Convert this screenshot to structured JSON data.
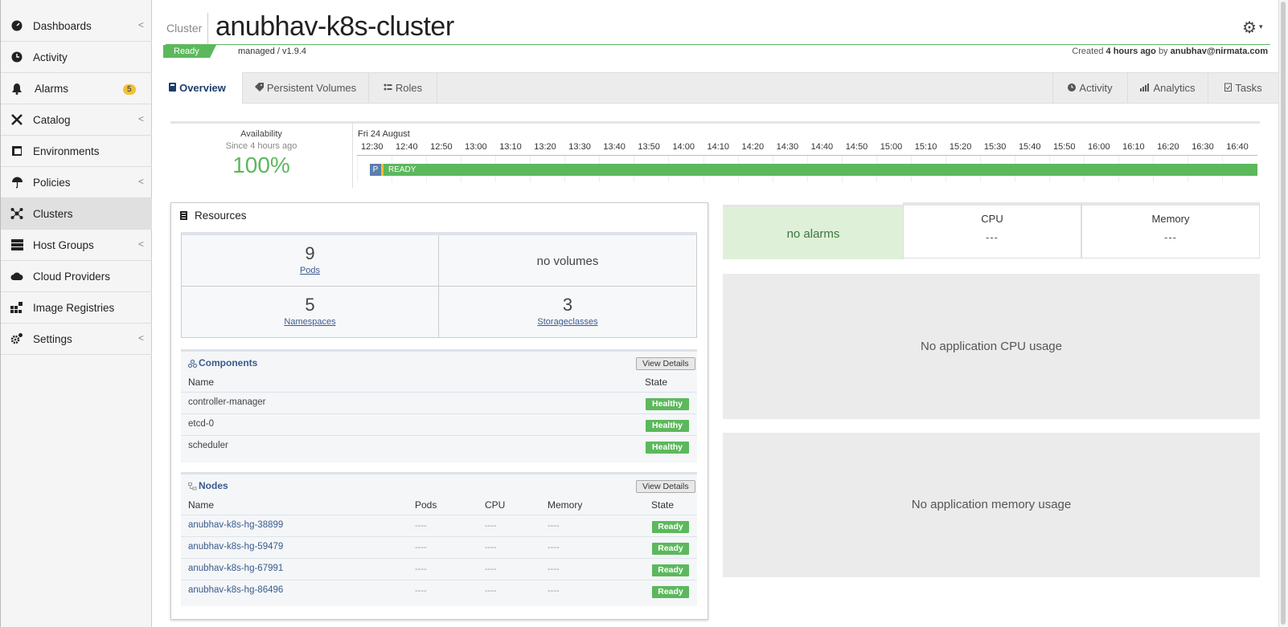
{
  "sidebar": {
    "items": [
      {
        "label": "Dashboards",
        "icon": "dashboard-icon",
        "chevron": "<"
      },
      {
        "label": "Activity",
        "icon": "activity-icon"
      },
      {
        "label": "Alarms",
        "icon": "bell-icon",
        "badge": "5"
      },
      {
        "label": "Catalog",
        "icon": "tools-icon",
        "chevron": "<"
      },
      {
        "label": "Environments",
        "icon": "environment-icon"
      },
      {
        "label": "Policies",
        "icon": "umbrella-icon",
        "chevron": "<"
      },
      {
        "label": "Clusters",
        "icon": "cluster-icon",
        "active": true
      },
      {
        "label": "Host Groups",
        "icon": "server-icon",
        "chevron": "<"
      },
      {
        "label": "Cloud Providers",
        "icon": "cloud-icon"
      },
      {
        "label": "Image Registries",
        "icon": "registry-icon"
      },
      {
        "label": "Settings",
        "icon": "cogs-icon",
        "chevron": "<"
      }
    ]
  },
  "header": {
    "sub": "Cluster",
    "title": "anubhav-k8s-cluster",
    "status": "Ready",
    "managed": "managed / v1.9.4",
    "created_prefix": "Created",
    "created_ago": "4 hours ago",
    "created_by_word": "by",
    "created_by": "anubhav@nirmata.com",
    "gear_caret": "▾"
  },
  "tabs": {
    "overview": "Overview",
    "pv": "Persistent Volumes",
    "roles": "Roles",
    "activity": "Activity",
    "analytics": "Analytics",
    "tasks": "Tasks"
  },
  "availability": {
    "label": "Availability",
    "since": "Since 4 hours ago",
    "percent": "100%"
  },
  "timeline": {
    "date": "Fri 24 August",
    "ticks": [
      "12:30",
      "12:40",
      "12:50",
      "13:00",
      "13:10",
      "13:20",
      "13:30",
      "13:40",
      "13:50",
      "14:00",
      "14:10",
      "14:20",
      "14:30",
      "14:40",
      "14:50",
      "15:00",
      "15:10",
      "15:20",
      "15:30",
      "15:40",
      "15:50",
      "16:00",
      "16:10",
      "16:20",
      "16:30",
      "16:40"
    ],
    "p_label": "P",
    "bar_label": "READY"
  },
  "resources": {
    "title": "Resources",
    "pods_count": "9",
    "pods_label": "Pods",
    "volumes": "no volumes",
    "ns_count": "5",
    "ns_label": "Namespaces",
    "sc_count": "3",
    "sc_label": "Storageclasses"
  },
  "components": {
    "title": "Components",
    "view_details": "View Details",
    "col_name": "Name",
    "col_state": "State",
    "rows": [
      {
        "name": "controller-manager",
        "state": "Healthy"
      },
      {
        "name": "etcd-0",
        "state": "Healthy"
      },
      {
        "name": "scheduler",
        "state": "Healthy"
      }
    ]
  },
  "nodes": {
    "title": "Nodes",
    "view_details": "View Details",
    "col_name": "Name",
    "col_pods": "Pods",
    "col_cpu": "CPU",
    "col_memory": "Memory",
    "col_state": "State",
    "rows": [
      {
        "name": "anubhav-k8s-hg-38899",
        "pods": "----",
        "cpu": "----",
        "memory": "----",
        "state": "Ready"
      },
      {
        "name": "anubhav-k8s-hg-59479",
        "pods": "----",
        "cpu": "----",
        "memory": "----",
        "state": "Ready"
      },
      {
        "name": "anubhav-k8s-hg-67991",
        "pods": "----",
        "cpu": "----",
        "memory": "----",
        "state": "Ready"
      },
      {
        "name": "anubhav-k8s-hg-86496",
        "pods": "----",
        "cpu": "----",
        "memory": "----",
        "state": "Ready"
      }
    ]
  },
  "right": {
    "alarms": "no alarms",
    "cpu_label": "CPU",
    "cpu_value": "---",
    "memory_label": "Memory",
    "memory_value": "---",
    "cpu_usage": "No application CPU usage",
    "memory_usage": "No application memory usage"
  },
  "colors": {
    "green": "#5cb85c",
    "link": "#3a5b8c",
    "badge": "#f0c036"
  }
}
